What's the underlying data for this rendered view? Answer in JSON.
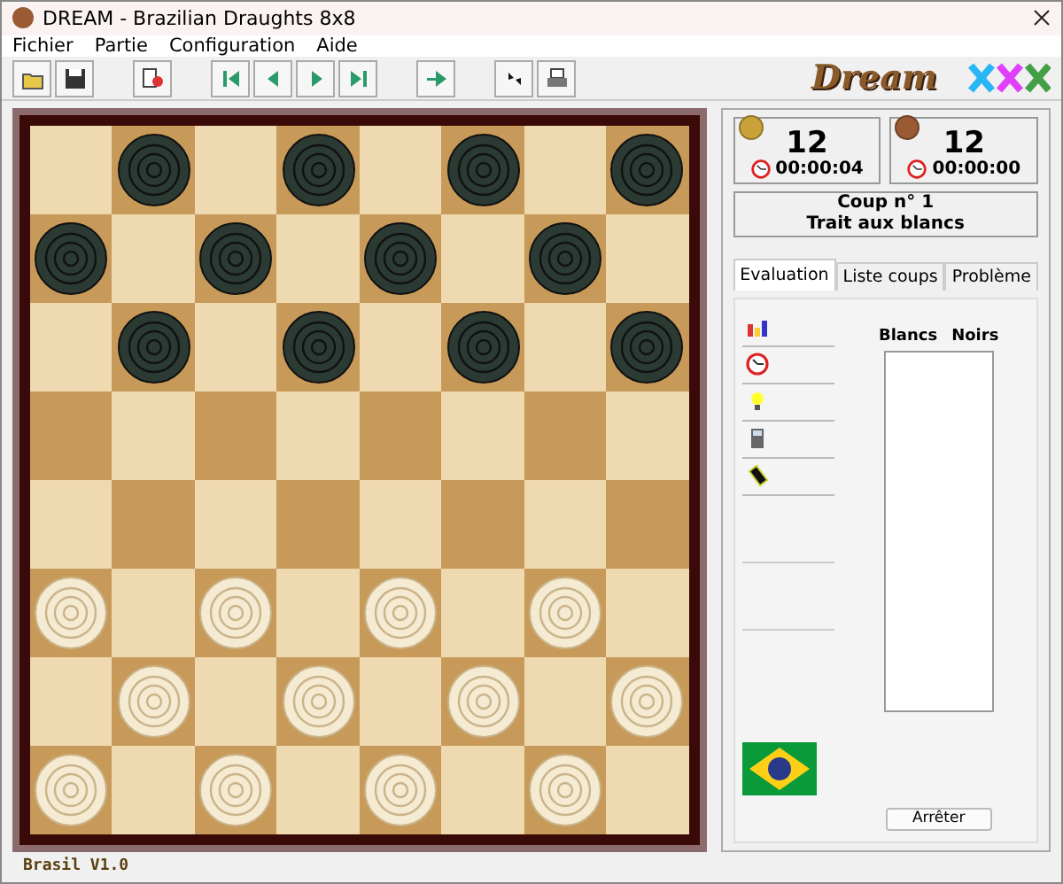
{
  "window": {
    "title": "DREAM - Brazilian Draughts 8x8"
  },
  "menu": [
    "Fichier",
    "Partie",
    "Configuration",
    "Aide"
  ],
  "toolbar": [
    {
      "kind": "open"
    },
    {
      "kind": "save"
    },
    {
      "kind": "gap"
    },
    {
      "kind": "edit"
    },
    {
      "kind": "gap"
    },
    {
      "kind": "first"
    },
    {
      "kind": "prev"
    },
    {
      "kind": "next"
    },
    {
      "kind": "last"
    },
    {
      "kind": "gap"
    },
    {
      "kind": "play"
    },
    {
      "kind": "gap"
    },
    {
      "kind": "swap"
    },
    {
      "kind": "print"
    }
  ],
  "logo": "Dream",
  "board": {
    "rows": [
      [
        {
          "kind": "empty"
        },
        {
          "kind": "dark"
        },
        {
          "kind": "empty"
        },
        {
          "kind": "dark"
        },
        {
          "kind": "empty"
        },
        {
          "kind": "dark"
        },
        {
          "kind": "empty"
        },
        {
          "kind": "dark"
        }
      ],
      [
        {
          "kind": "dark"
        },
        {
          "kind": "empty"
        },
        {
          "kind": "dark"
        },
        {
          "kind": "empty"
        },
        {
          "kind": "dark"
        },
        {
          "kind": "empty"
        },
        {
          "kind": "dark"
        },
        {
          "kind": "empty"
        }
      ],
      [
        {
          "kind": "empty"
        },
        {
          "kind": "dark"
        },
        {
          "kind": "empty"
        },
        {
          "kind": "dark"
        },
        {
          "kind": "empty"
        },
        {
          "kind": "dark"
        },
        {
          "kind": "empty"
        },
        {
          "kind": "dark"
        }
      ],
      [
        {
          "kind": "empty"
        },
        {
          "kind": "empty"
        },
        {
          "kind": "empty"
        },
        {
          "kind": "empty"
        },
        {
          "kind": "empty"
        },
        {
          "kind": "empty"
        },
        {
          "kind": "empty"
        },
        {
          "kind": "empty"
        }
      ],
      [
        {
          "kind": "empty"
        },
        {
          "kind": "empty"
        },
        {
          "kind": "empty"
        },
        {
          "kind": "empty"
        },
        {
          "kind": "empty"
        },
        {
          "kind": "empty"
        },
        {
          "kind": "empty"
        },
        {
          "kind": "empty"
        }
      ],
      [
        {
          "kind": "light"
        },
        {
          "kind": "empty"
        },
        {
          "kind": "light"
        },
        {
          "kind": "empty"
        },
        {
          "kind": "light"
        },
        {
          "kind": "empty"
        },
        {
          "kind": "light"
        },
        {
          "kind": "empty"
        }
      ],
      [
        {
          "kind": "empty"
        },
        {
          "kind": "light"
        },
        {
          "kind": "empty"
        },
        {
          "kind": "light"
        },
        {
          "kind": "empty"
        },
        {
          "kind": "light"
        },
        {
          "kind": "empty"
        },
        {
          "kind": "light"
        }
      ],
      [
        {
          "kind": "light"
        },
        {
          "kind": "empty"
        },
        {
          "kind": "light"
        },
        {
          "kind": "empty"
        },
        {
          "kind": "light"
        },
        {
          "kind": "empty"
        },
        {
          "kind": "light"
        },
        {
          "kind": "empty"
        }
      ]
    ]
  },
  "players": [
    {
      "color": "#c9a23a",
      "count": "12",
      "time": "00:00:04"
    },
    {
      "color": "#9a5a34",
      "count": "12",
      "time": "00:00:00"
    }
  ],
  "status": {
    "move": "Coup n° 1",
    "turn": "Trait aux blancs"
  },
  "tabs": [
    {
      "label": "Evaluation",
      "selected": true
    },
    {
      "label": "Liste coups",
      "selected": false
    },
    {
      "label": "Problème",
      "selected": false
    }
  ],
  "tools": [
    {
      "kind": "chart"
    },
    {
      "kind": "clock"
    },
    {
      "kind": "bulb"
    },
    {
      "kind": "calc"
    },
    {
      "kind": "chip"
    }
  ],
  "moves": {
    "columns": [
      "Blancs",
      "Noirs"
    ]
  },
  "stop_button": "Arrêter",
  "status_bar": "Brasil V1.0"
}
